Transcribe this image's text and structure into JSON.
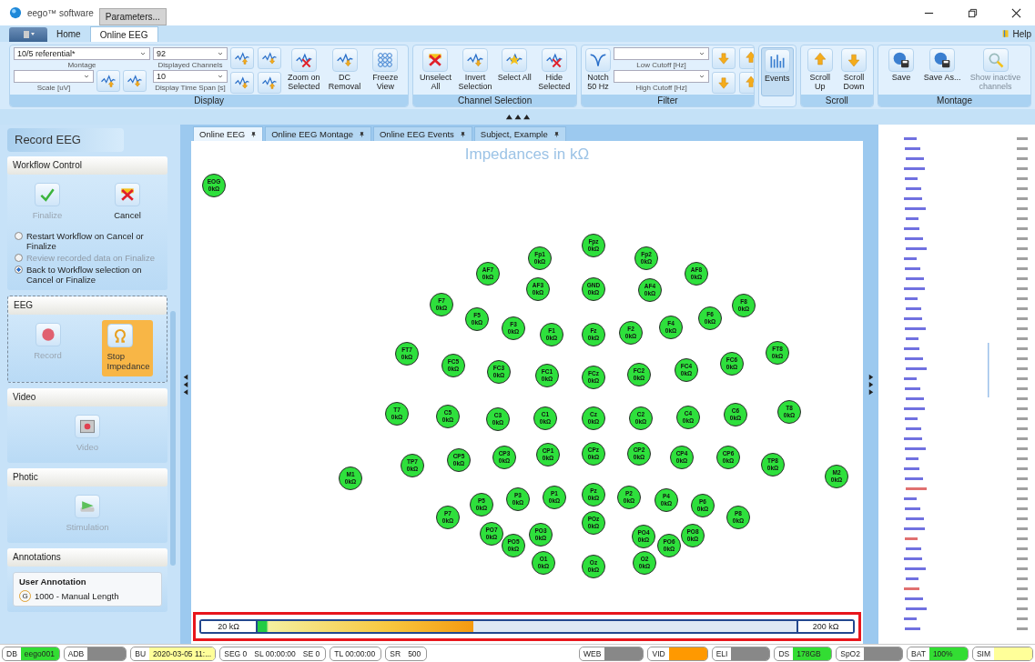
{
  "window": {
    "title": "eego™ software",
    "tab": "Parameters..."
  },
  "ribbon": {
    "tabs": [
      {
        "label": "Home",
        "selected": false
      },
      {
        "label": "Online EEG",
        "selected": true
      }
    ],
    "help": "Help",
    "groups": [
      {
        "kind": "display",
        "title": "Display",
        "montage": {
          "value": "10/5 referential*",
          "label": "Montage"
        },
        "scale": {
          "label": "Scale [uV]"
        },
        "channels": {
          "value": "92",
          "label": "Displayed Channels"
        },
        "time_span": {
          "value": "10",
          "label": "Display Time Span [s]"
        },
        "buttons": [
          {
            "label": "Zoom on Selected",
            "pressed": false,
            "disabled": false
          },
          {
            "label": "DC Removal",
            "pressed": false,
            "disabled": false
          },
          {
            "label": "Freeze View",
            "pressed": false,
            "disabled": false
          }
        ]
      },
      {
        "kind": "buttons",
        "title": "Channel Selection",
        "buttons": [
          {
            "label": "Unselect All",
            "pressed": false,
            "disabled": false
          },
          {
            "label": "Invert Selection",
            "pressed": false,
            "disabled": false
          },
          {
            "label": "Select All",
            "pressed": false,
            "disabled": false
          },
          {
            "label": "Hide Selected",
            "pressed": false,
            "disabled": false
          }
        ]
      },
      {
        "kind": "filter",
        "title": "Filter",
        "buttons": [
          {
            "label": "Notch 50 Hz",
            "pressed": false,
            "disabled": false
          }
        ],
        "low_cutoff": {
          "label": "Low Cutoff [Hz]"
        },
        "high_cutoff": {
          "label": "High Cutoff [Hz]"
        }
      },
      {
        "kind": "buttons",
        "buttons": [
          {
            "label": "Events",
            "pressed": true,
            "disabled": false
          }
        ]
      },
      {
        "kind": "buttons",
        "title": "Scroll",
        "buttons": [
          {
            "label": "Scroll Up",
            "pressed": false,
            "disabled": false
          },
          {
            "label": "Scroll Down",
            "pressed": false,
            "disabled": false
          }
        ]
      },
      {
        "kind": "buttons",
        "title": "Montage",
        "buttons": [
          {
            "label": "Save",
            "pressed": false,
            "disabled": false
          },
          {
            "label": "Save As...",
            "pressed": false,
            "disabled": false
          },
          {
            "label": "Show inactive channels",
            "pressed": false,
            "disabled": true
          }
        ]
      }
    ]
  },
  "left_panel": {
    "title": "Record EEG",
    "sections": [
      {
        "title": "Workflow Control",
        "buttons": [
          {
            "label": "Finalize",
            "disabled": true,
            "active": false
          },
          {
            "label": "Cancel",
            "disabled": false,
            "active": false
          }
        ],
        "options": [
          {
            "label": "Restart Workflow on Cancel or Finalize",
            "selected": false,
            "disabled": false
          },
          {
            "label": "Review recorded data on Finalize",
            "selected": false,
            "disabled": true
          },
          {
            "label": "Back to Workflow selection on Cancel or Finalize",
            "selected": true,
            "disabled": false
          }
        ]
      },
      {
        "title": "EEG",
        "buttons": [
          {
            "label": "Record",
            "disabled": true,
            "active": false
          },
          {
            "label": "Stop Impedance",
            "disabled": false,
            "active": true
          }
        ]
      },
      {
        "title": "Video",
        "buttons": [
          {
            "label": "Video",
            "disabled": true,
            "active": false
          }
        ]
      },
      {
        "title": "Photic",
        "buttons": [
          {
            "label": "Stimulation",
            "disabled": true,
            "active": false
          }
        ]
      },
      {
        "title": "Annotations",
        "annotation": {
          "title": "User Annotation",
          "key": "G",
          "text": "1000 - Manual Length"
        }
      }
    ]
  },
  "doc_tabs": [
    {
      "label": "Online EEG",
      "selected": true
    },
    {
      "label": "Online EEG Montage",
      "selected": false
    },
    {
      "label": "Online EEG Events",
      "selected": false
    },
    {
      "label": "Subject, Example",
      "selected": false
    }
  ],
  "plot": {
    "title": "Impedances in kΩ",
    "electrodes": [
      {
        "label": "EOG",
        "value": "0kΩ",
        "color": "#2ee03c"
      },
      {
        "label": "Fpz",
        "value": "0kΩ",
        "color": "#2ee03c"
      },
      {
        "label": "Fp1",
        "value": "0kΩ",
        "color": "#2ee03c"
      },
      {
        "label": "Fp2",
        "value": "0kΩ",
        "color": "#2ee03c"
      },
      {
        "label": "AF7",
        "value": "0kΩ",
        "color": "#2ee03c"
      },
      {
        "label": "AF3",
        "value": "0kΩ",
        "color": "#2ee03c"
      },
      {
        "label": "GND",
        "value": "0kΩ",
        "color": "#2ee03c"
      },
      {
        "label": "AF4",
        "value": "0kΩ",
        "color": "#2ee03c"
      },
      {
        "label": "AF8",
        "value": "0kΩ",
        "color": "#2ee03c"
      },
      {
        "label": "F7",
        "value": "0kΩ",
        "color": "#2ee03c"
      },
      {
        "label": "F5",
        "value": "0kΩ",
        "color": "#2ee03c"
      },
      {
        "label": "F3",
        "value": "0kΩ",
        "color": "#2ee03c"
      },
      {
        "label": "F1",
        "value": "0kΩ",
        "color": "#2ee03c"
      },
      {
        "label": "Fz",
        "value": "0kΩ",
        "color": "#2ee03c"
      },
      {
        "label": "F2",
        "value": "0kΩ",
        "color": "#2ee03c"
      },
      {
        "label": "F4",
        "value": "0kΩ",
        "color": "#2ee03c"
      },
      {
        "label": "F6",
        "value": "0kΩ",
        "color": "#2ee03c"
      },
      {
        "label": "F8",
        "value": "0kΩ",
        "color": "#2ee03c"
      },
      {
        "label": "FT7",
        "value": "0kΩ",
        "color": "#2ee03c"
      },
      {
        "label": "FC5",
        "value": "0kΩ",
        "color": "#2ee03c"
      },
      {
        "label": "FC3",
        "value": "0kΩ",
        "color": "#2ee03c"
      },
      {
        "label": "FC1",
        "value": "0kΩ",
        "color": "#2ee03c"
      },
      {
        "label": "FCz",
        "value": "0kΩ",
        "color": "#2ee03c"
      },
      {
        "label": "FC2",
        "value": "0kΩ",
        "color": "#2ee03c"
      },
      {
        "label": "FC4",
        "value": "0kΩ",
        "color": "#2ee03c"
      },
      {
        "label": "FC6",
        "value": "0kΩ",
        "color": "#2ee03c"
      },
      {
        "label": "FT8",
        "value": "0kΩ",
        "color": "#2ee03c"
      },
      {
        "label": "T7",
        "value": "0kΩ",
        "color": "#2ee03c"
      },
      {
        "label": "C5",
        "value": "0kΩ",
        "color": "#2ee03c"
      },
      {
        "label": "C3",
        "value": "0kΩ",
        "color": "#2ee03c"
      },
      {
        "label": "C1",
        "value": "0kΩ",
        "color": "#2ee03c"
      },
      {
        "label": "Cz",
        "value": "0kΩ",
        "color": "#2ee03c"
      },
      {
        "label": "C2",
        "value": "0kΩ",
        "color": "#2ee03c"
      },
      {
        "label": "C4",
        "value": "0kΩ",
        "color": "#2ee03c"
      },
      {
        "label": "C6",
        "value": "0kΩ",
        "color": "#2ee03c"
      },
      {
        "label": "T8",
        "value": "0kΩ",
        "color": "#2ee03c"
      },
      {
        "label": "M1",
        "value": "0kΩ",
        "color": "#2ee03c"
      },
      {
        "label": "TP7",
        "value": "0kΩ",
        "color": "#2ee03c"
      },
      {
        "label": "CP5",
        "value": "0kΩ",
        "color": "#2ee03c"
      },
      {
        "label": "CP3",
        "value": "0kΩ",
        "color": "#2ee03c"
      },
      {
        "label": "CP1",
        "value": "0kΩ",
        "color": "#2ee03c"
      },
      {
        "label": "CPz",
        "value": "0kΩ",
        "color": "#2ee03c"
      },
      {
        "label": "CP2",
        "value": "0kΩ",
        "color": "#2ee03c"
      },
      {
        "label": "CP4",
        "value": "0kΩ",
        "color": "#2ee03c"
      },
      {
        "label": "CP6",
        "value": "0kΩ",
        "color": "#2ee03c"
      },
      {
        "label": "TP8",
        "value": "0kΩ",
        "color": "#2ee03c"
      },
      {
        "label": "M2",
        "value": "0kΩ",
        "color": "#2ee03c"
      },
      {
        "label": "P7",
        "value": "0kΩ",
        "color": "#2ee03c"
      },
      {
        "label": "P5",
        "value": "0kΩ",
        "color": "#2ee03c"
      },
      {
        "label": "P3",
        "value": "0kΩ",
        "color": "#2ee03c"
      },
      {
        "label": "P1",
        "value": "0kΩ",
        "color": "#2ee03c"
      },
      {
        "label": "Pz",
        "value": "0kΩ",
        "color": "#2ee03c"
      },
      {
        "label": "P2",
        "value": "0kΩ",
        "color": "#2ee03c"
      },
      {
        "label": "P4",
        "value": "0kΩ",
        "color": "#2ee03c"
      },
      {
        "label": "P6",
        "value": "0kΩ",
        "color": "#2ee03c"
      },
      {
        "label": "P8",
        "value": "0kΩ",
        "color": "#2ee03c"
      },
      {
        "label": "PO7",
        "value": "0kΩ",
        "color": "#2ee03c"
      },
      {
        "label": "PO5",
        "value": "0kΩ",
        "color": "#2ee03c"
      },
      {
        "label": "PO3",
        "value": "0kΩ",
        "color": "#2ee03c"
      },
      {
        "label": "POz",
        "value": "0kΩ",
        "color": "#2ee03c"
      },
      {
        "label": "PO4",
        "value": "0kΩ",
        "color": "#2ee03c"
      },
      {
        "label": "PO6",
        "value": "0kΩ",
        "color": "#2ee03c"
      },
      {
        "label": "PO8",
        "value": "0kΩ",
        "color": "#2ee03c"
      },
      {
        "label": "O1",
        "value": "0kΩ",
        "color": "#2ee03c"
      },
      {
        "label": "Oz",
        "value": "0kΩ",
        "color": "#2ee03c"
      },
      {
        "label": "O2",
        "value": "0kΩ",
        "color": "#2ee03c"
      }
    ],
    "scale": {
      "min_label": "20 kΩ",
      "max_label": "200 kΩ",
      "level": 0.4
    }
  },
  "status_bar": {
    "items": [
      {
        "kind": "indicator",
        "label": "DB",
        "value": "eego001",
        "color": "#33dd33"
      },
      {
        "kind": "indicator",
        "label": "ADB",
        "color": "#888888"
      },
      {
        "kind": "indicator",
        "label": "BU",
        "value": "2020-03-05 11:...",
        "color": "#ffff99"
      },
      {
        "kind": "text",
        "texts": [
          "SEG 0",
          "SL 00:00:00",
          "SE 0"
        ]
      },
      {
        "kind": "text",
        "texts": [
          "TL 00:00:00"
        ]
      },
      {
        "kind": "text",
        "texts": [
          "SR",
          "500"
        ]
      },
      {
        "kind": "indicator",
        "label": "WEB",
        "color": "#888888"
      },
      {
        "kind": "indicator",
        "label": "VID",
        "color": "#ff9900"
      },
      {
        "kind": "indicator",
        "label": "ELI",
        "color": "#888888"
      },
      {
        "kind": "indicator",
        "label": "DS",
        "value": "178GB",
        "color": "#33dd33"
      },
      {
        "kind": "indicator",
        "label": "SpO2",
        "color": "#888888"
      },
      {
        "kind": "indicator",
        "label": "BAT",
        "value": "100%",
        "color": "#33dd33"
      },
      {
        "kind": "indicator",
        "label": "SIM",
        "color": "#ffff99"
      }
    ]
  }
}
